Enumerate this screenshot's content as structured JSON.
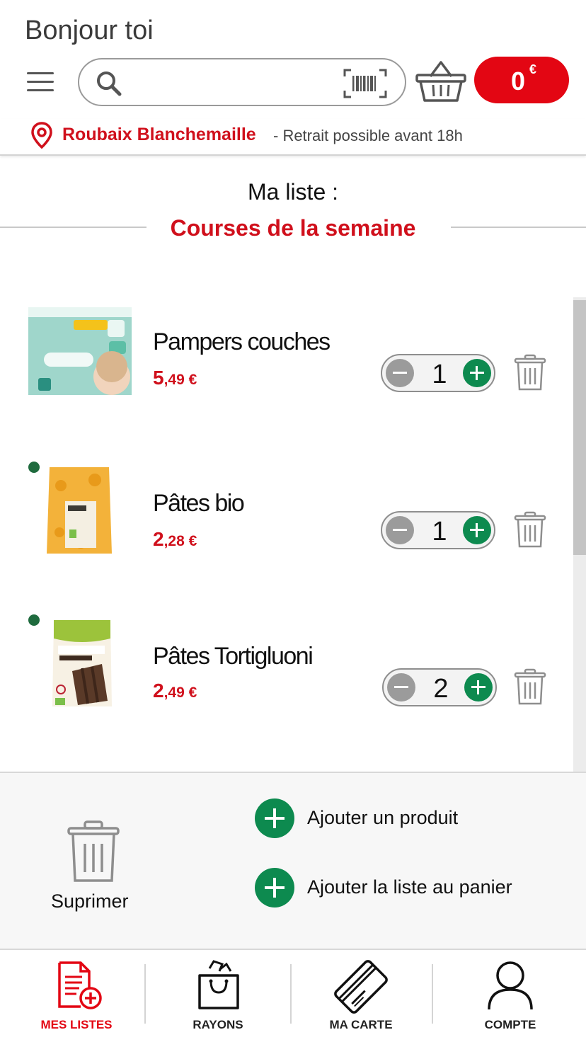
{
  "header": {
    "greeting": "Bonjour toi",
    "search_placeholder": "",
    "cart_amount": "0",
    "cart_currency": "€"
  },
  "store": {
    "name": "Roubaix Blanchemaille",
    "note": "- Retrait possible avant 18h"
  },
  "list": {
    "label": "Ma liste :",
    "name": "Courses de la semaine"
  },
  "products": [
    {
      "name": "Pampers couches",
      "price_main": "5",
      "price_rest": ",49 €",
      "quantity": "1",
      "bio": false
    },
    {
      "name": "Pâtes bio",
      "price_main": "2",
      "price_rest": ",28 €",
      "quantity": "1",
      "bio": true
    },
    {
      "name": "Pâtes Tortigluoni",
      "price_main": "2",
      "price_rest": ",49 €",
      "quantity": "2",
      "bio": true
    }
  ],
  "actions": {
    "delete_label": "Suprimer",
    "add_product": "Ajouter un produit",
    "add_list_to_cart": "Ajouter la liste au panier"
  },
  "nav": [
    {
      "label": "MES LISTES",
      "icon": "list-add-icon",
      "active": true
    },
    {
      "label": "RAYONS",
      "icon": "shopping-bag-icon",
      "active": false
    },
    {
      "label": "MA CARTE",
      "icon": "loyalty-card-icon",
      "active": false
    },
    {
      "label": "COMPTE",
      "icon": "user-icon",
      "active": false
    }
  ],
  "colors": {
    "brand_red": "#e30613",
    "accent_green": "#0d8a4f"
  }
}
